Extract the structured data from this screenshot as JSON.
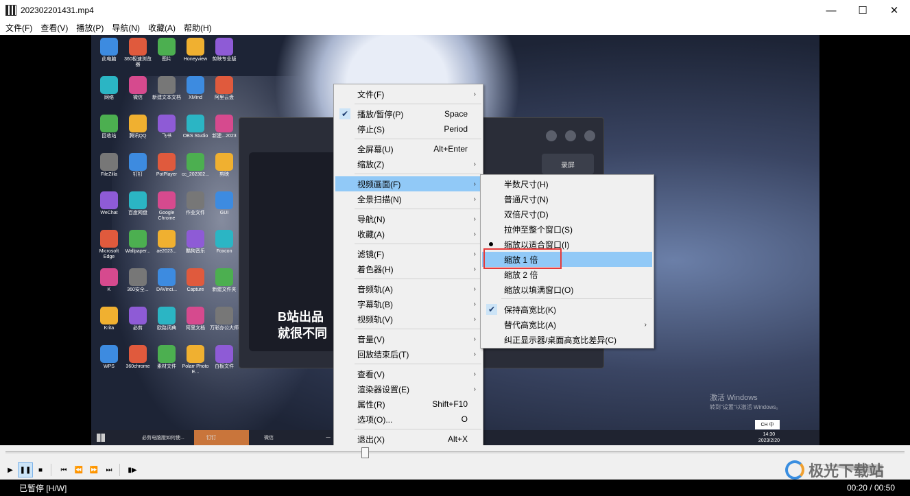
{
  "window": {
    "title": "202302201431.mp4",
    "minimize": "—",
    "maximize": "☐",
    "close": "✕"
  },
  "menubar": [
    "文件(F)",
    "查看(V)",
    "播放(P)",
    "导航(N)",
    "收藏(A)",
    "帮助(H)"
  ],
  "desktop": {
    "icons": [
      "此电脑",
      "360极速浏览器",
      "图片",
      "Honeyview",
      "剪映专业版",
      "网络",
      "微信",
      "新建文本文档",
      "XMind",
      "阿里云盘",
      "回收站",
      "腾讯QQ",
      "飞书",
      "OBS Studio",
      "新建...2023",
      "FileZilla",
      "钉钉",
      "PotPlayer",
      "cc_202302...",
      "剪映",
      "WeChat",
      "百度网盘",
      "Google Chrome",
      "作业文件",
      "GUI",
      "Microsoft Edge",
      "Wallpaper...",
      "ae2023...",
      "酷狗音乐",
      "Foxcon",
      "K",
      "360安全...",
      "DAVinci...",
      "Capture",
      "新建文件夹",
      "Krita",
      "必剪",
      "欧路词典",
      "阿里文档",
      "万彩办公大师",
      "WPS",
      "360chrome",
      "素材文件",
      "Polarr Photo E...",
      "白板文件"
    ],
    "dialog_text": [
      "B站出品",
      "就很不同"
    ],
    "record_label": "录屏",
    "taskbar": [
      "必剪电脑版如何使...",
      "钉钉",
      "微信",
      "一"
    ],
    "clock_time": "14:30",
    "clock_date": "2023/2/20",
    "activate_line1": "激活 Windows",
    "activate_line2": "转到\"设置\"以激活 Windows。",
    "ime": "CH 中"
  },
  "context_menu": {
    "items": [
      {
        "label": "文件(F)",
        "accel": "",
        "submenu": true
      },
      {
        "label": "播放/暂停(P)",
        "accel": "Space",
        "checked": true
      },
      {
        "label": "停止(S)",
        "accel": "Period"
      },
      {
        "label": "全屏幕(U)",
        "accel": "Alt+Enter"
      },
      {
        "label": "缩放(Z)",
        "accel": "",
        "submenu": true
      },
      {
        "label": "视频画面(F)",
        "accel": "",
        "submenu": true,
        "highlight": true
      },
      {
        "label": "全景扫描(N)",
        "accel": "",
        "submenu": true
      },
      {
        "label": "导航(N)",
        "accel": "",
        "submenu": true
      },
      {
        "label": "收藏(A)",
        "accel": "",
        "submenu": true
      },
      {
        "label": "滤镜(F)",
        "accel": "",
        "submenu": true
      },
      {
        "label": "着色器(H)",
        "accel": "",
        "submenu": true
      },
      {
        "label": "音频轨(A)",
        "accel": "",
        "submenu": true
      },
      {
        "label": "字幕轨(B)",
        "accel": "",
        "submenu": true
      },
      {
        "label": "视频轨(V)",
        "accel": "",
        "submenu": true
      },
      {
        "label": "音量(V)",
        "accel": "",
        "submenu": true
      },
      {
        "label": "回放结束后(T)",
        "accel": "",
        "submenu": true
      },
      {
        "label": "查看(V)",
        "accel": "",
        "submenu": true
      },
      {
        "label": "渲染器设置(E)",
        "accel": "",
        "submenu": true
      },
      {
        "label": "属性(R)",
        "accel": "Shift+F10"
      },
      {
        "label": "选项(O)...",
        "accel": "O"
      },
      {
        "label": "退出(X)",
        "accel": "Alt+X"
      }
    ]
  },
  "submenu": {
    "items": [
      {
        "label": "半数尺寸(H)"
      },
      {
        "label": "普通尺寸(N)"
      },
      {
        "label": "双倍尺寸(D)"
      },
      {
        "label": "拉伸至整个窗口(S)"
      },
      {
        "label": "缩放以适合窗口(I)",
        "bullet": true
      },
      {
        "label": "缩放 1 倍",
        "highlight": true
      },
      {
        "label": "缩放 2 倍"
      },
      {
        "label": "缩放以填满窗口(O)"
      },
      {
        "label": "保持高宽比(K)",
        "checked": true
      },
      {
        "label": "替代高宽比(A)",
        "submenu": true
      },
      {
        "label": "纠正显示器/桌面高宽比差异(C)"
      }
    ]
  },
  "playback": {
    "progress_fraction": 0.4,
    "status": "已暂停 [H/W]",
    "time": "00:20 / 00:50"
  },
  "watermark": "极光下载站",
  "icons_used": [
    "play-icon",
    "pause-icon",
    "stop-icon",
    "skip-back-icon",
    "rewind-icon",
    "forward-icon",
    "skip-forward-icon",
    "frame-step-icon",
    "check-icon",
    "chevron-right-icon"
  ]
}
